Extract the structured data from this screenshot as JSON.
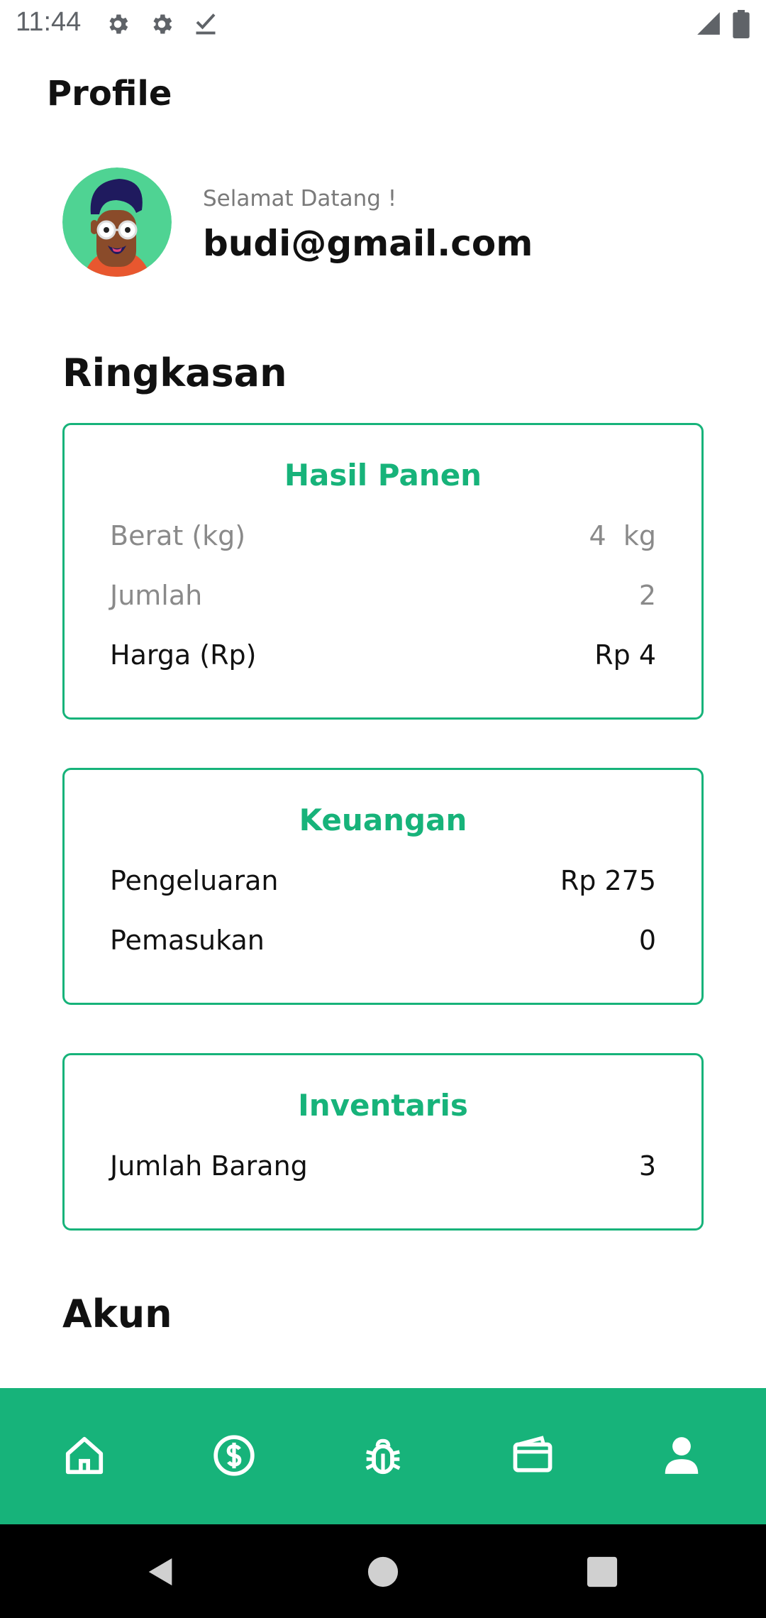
{
  "status_bar": {
    "time": "11:44",
    "icons": [
      "gear-icon",
      "gear-icon",
      "checkmark-download-icon",
      "signal-icon",
      "battery-icon"
    ]
  },
  "header": {
    "title": "Profile"
  },
  "profile": {
    "greeting": "Selamat Datang !",
    "email": "budi@gmail.com"
  },
  "summary": {
    "title": "Ringkasan",
    "harvest": {
      "title": "Hasil Panen",
      "rows": [
        {
          "label": "Berat (kg)",
          "value": "4  kg"
        },
        {
          "label": "Jumlah",
          "value": "2"
        },
        {
          "label": "Harga (Rp)",
          "value": "Rp 4"
        }
      ]
    },
    "finance": {
      "title": "Keuangan",
      "rows": [
        {
          "label": "Pengeluaran",
          "value": "Rp 275"
        },
        {
          "label": "Pemasukan",
          "value": "0"
        }
      ]
    },
    "inventory": {
      "title": "Inventaris",
      "rows": [
        {
          "label": "Jumlah Barang",
          "value": "3"
        }
      ]
    }
  },
  "account": {
    "title": "Akun"
  },
  "bottom_nav": {
    "items": [
      "home-icon",
      "dollar-icon",
      "bug-icon",
      "wallet-icon",
      "person-icon"
    ],
    "active": "person-icon"
  },
  "colors": {
    "accent": "#17b37a",
    "avatar_bg": "#4fd393"
  }
}
